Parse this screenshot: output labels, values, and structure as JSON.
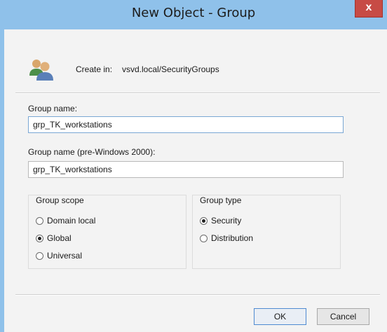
{
  "window": {
    "title": "New Object - Group",
    "close_label": "x"
  },
  "header": {
    "icon": "group-users-icon",
    "create_in_label": "Create in:",
    "create_in_value": "vsvd.local/SecurityGroups"
  },
  "form": {
    "group_name_label": "Group name:",
    "group_name_value": "grp_TK_workstations",
    "group_name_pre2000_label": "Group name (pre-Windows 2000):",
    "group_name_pre2000_value": "grp_TK_workstations"
  },
  "group_scope": {
    "title": "Group scope",
    "options": [
      {
        "label": "Domain local",
        "checked": false
      },
      {
        "label": "Global",
        "checked": true
      },
      {
        "label": "Universal",
        "checked": false
      }
    ]
  },
  "group_type": {
    "title": "Group type",
    "options": [
      {
        "label": "Security",
        "checked": true
      },
      {
        "label": "Distribution",
        "checked": false
      }
    ]
  },
  "buttons": {
    "ok": "OK",
    "cancel": "Cancel"
  },
  "colors": {
    "titlebar": "#8fc1ea",
    "close": "#c74b45",
    "dialog_bg": "#f3f3f3"
  }
}
